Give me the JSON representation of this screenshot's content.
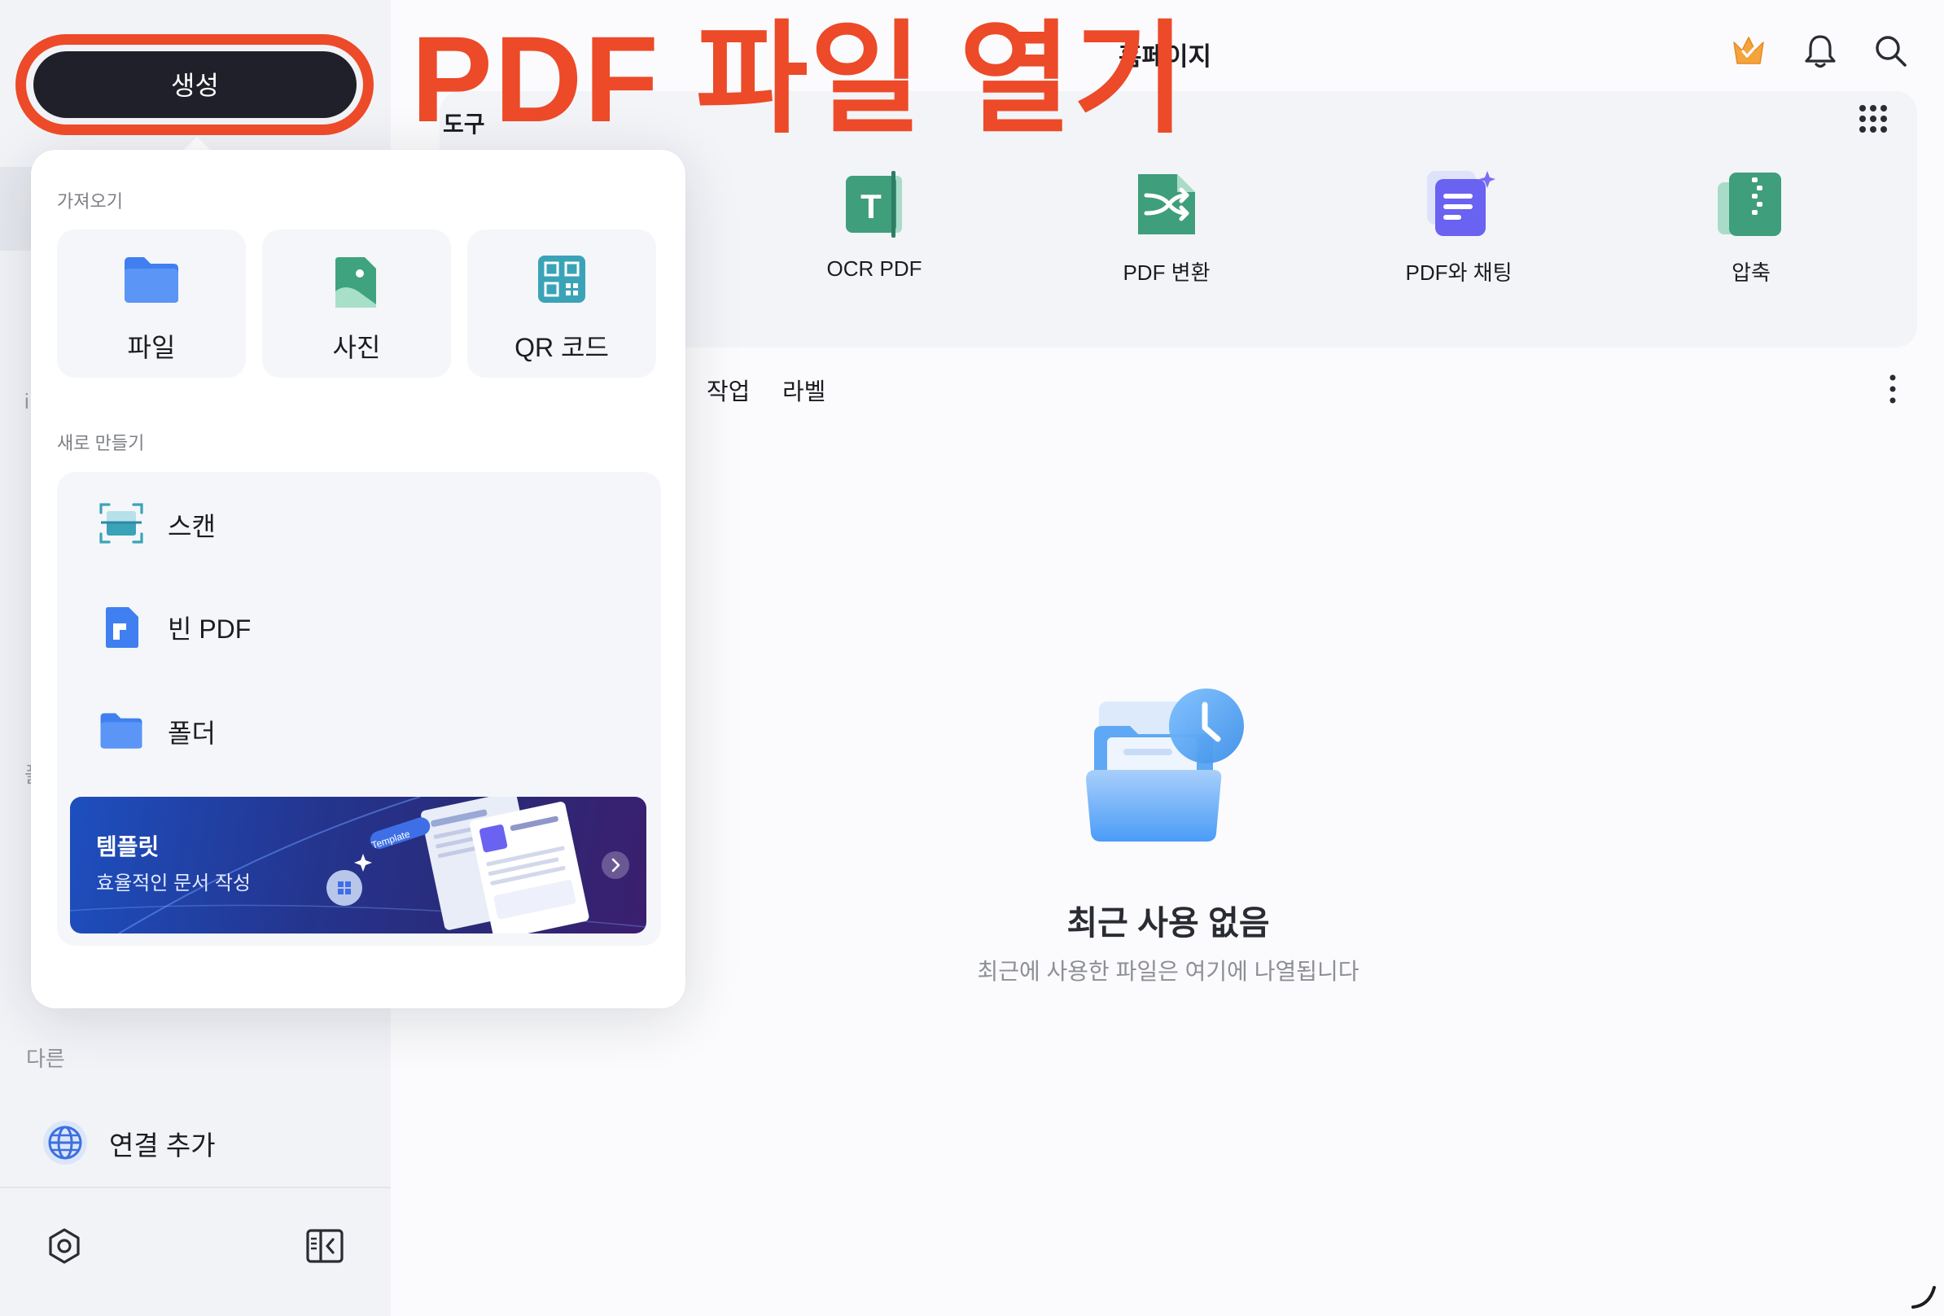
{
  "header": {
    "title": "홈페이지"
  },
  "annotation": {
    "text": "PDF 파일 열기"
  },
  "create_button": {
    "label": "생성"
  },
  "tools": {
    "title": "도구",
    "items": [
      {
        "label": "OCR PDF",
        "icon": "ocr-icon"
      },
      {
        "label": "PDF 변환",
        "icon": "convert-icon"
      },
      {
        "label": "PDF와 채팅",
        "icon": "chat-icon"
      },
      {
        "label": "압축",
        "icon": "compress-icon"
      }
    ]
  },
  "recent_tabs": [
    "작업",
    "라벨"
  ],
  "empty_state": {
    "title": "최근 사용 없음",
    "subtitle": "최근에 사용한 파일은 여기에 나열됩니다"
  },
  "popover": {
    "import_title": "가져오기",
    "import_items": [
      {
        "label": "파일",
        "icon": "folder-icon"
      },
      {
        "label": "사진",
        "icon": "photo-icon"
      },
      {
        "label": "QR 코드",
        "icon": "qr-code-icon"
      }
    ],
    "new_title": "새로 만들기",
    "new_items": [
      {
        "label": "스캔",
        "icon": "scan-icon"
      },
      {
        "label": "빈 PDF",
        "icon": "blank-pdf-icon"
      },
      {
        "label": "폴더",
        "icon": "folder-icon"
      }
    ],
    "banner": {
      "title": "템플릿",
      "subtitle": "효율적인 문서 작성",
      "tag": "Template"
    }
  },
  "sidebar": {
    "other_title": "다른",
    "add_connection_label": "연결 추가",
    "fragments": [
      "i",
      "폴"
    ]
  },
  "colors": {
    "accent_red": "#ec4a28",
    "create_button_bg": "#1f2029",
    "sidebar_bg": "#f2f3f7",
    "tool_green": "#3f9e7c",
    "tool_purple": "#6a62f0"
  }
}
